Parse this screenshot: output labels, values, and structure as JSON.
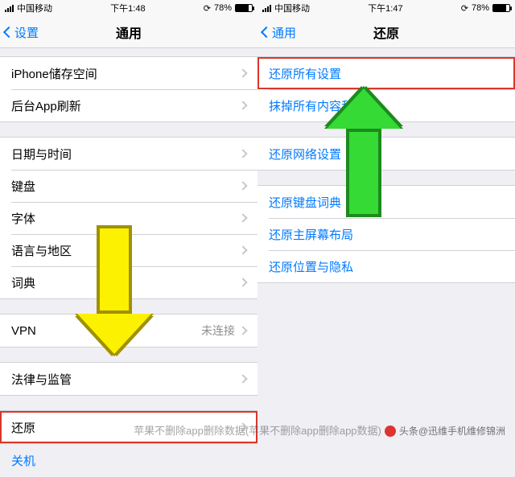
{
  "left": {
    "status": {
      "carrier": "中国移动",
      "time": "下午1:48",
      "battery_pct": "78%"
    },
    "nav": {
      "back": "设置",
      "title": "通用"
    },
    "group1": [
      {
        "label": "iPhone储存空间"
      },
      {
        "label": "后台App刷新"
      }
    ],
    "group2": [
      {
        "label": "日期与时间"
      },
      {
        "label": "键盘"
      },
      {
        "label": "字体"
      },
      {
        "label": "语言与地区"
      },
      {
        "label": "词典"
      }
    ],
    "group3": [
      {
        "label": "VPN",
        "detail": "未连接"
      }
    ],
    "group4": [
      {
        "label": "法律与监管"
      }
    ],
    "group5": [
      {
        "label": "还原"
      }
    ],
    "shutdown": "关机"
  },
  "right": {
    "status": {
      "carrier": "中国移动",
      "time": "下午1:47",
      "battery_pct": "78%"
    },
    "nav": {
      "back": "通用",
      "title": "还原"
    },
    "group1": [
      {
        "label": "还原所有设置"
      },
      {
        "label": "抹掉所有内容和设置"
      }
    ],
    "group2": [
      {
        "label": "还原网络设置"
      }
    ],
    "group3": [
      {
        "label": "还原键盘词典"
      },
      {
        "label": "还原主屏幕布局"
      },
      {
        "label": "还原位置与隐私"
      }
    ]
  },
  "watermark_center": "苹果不删除app删除数据(苹果不删除app删除app数据)",
  "watermark_right": "头条@迅维手机维修锦洲"
}
